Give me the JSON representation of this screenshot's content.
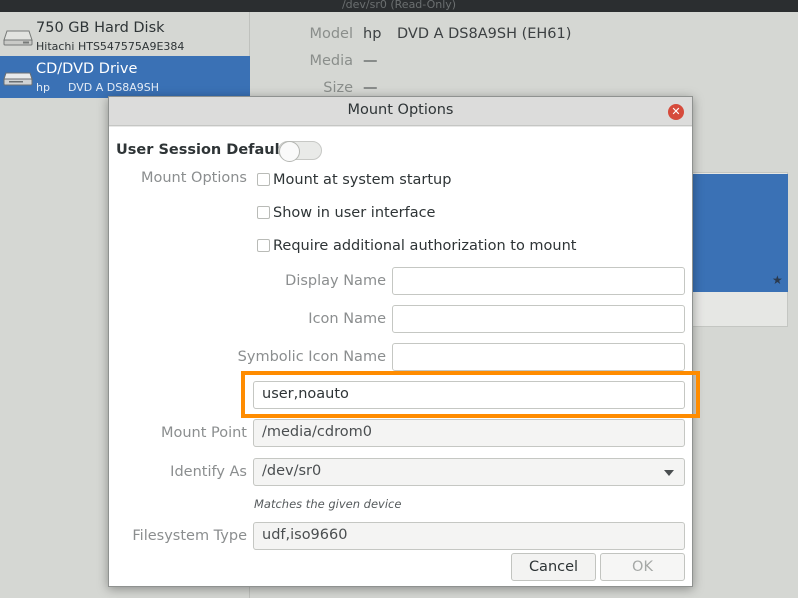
{
  "window": {
    "title": "/dev/sr0 (Read-Only)"
  },
  "sidebar": {
    "items": [
      {
        "name": "750 GB Hard Disk",
        "vendor": "Hitachi HTS547575A9E384",
        "model": "",
        "icon": "harddisk-icon",
        "selected": false
      },
      {
        "name": "CD/DVD Drive",
        "vendor": "hp",
        "model": "DVD A  DS8A9SH",
        "icon": "optical-drive-icon",
        "selected": true
      }
    ]
  },
  "details": {
    "model_label": "Model",
    "model_vendor": "hp",
    "model_value": "DVD A  DS8A9SH (EH61)",
    "media_label": "Media",
    "media_value": "—",
    "size_label": "Size",
    "size_value": "—"
  },
  "dialog": {
    "title": "Mount Options",
    "user_session_defaults_label": "User Session Defaults",
    "user_session_defaults_on": false,
    "mount_options_label": "Mount Options",
    "mount_at_startup_label": "Mount at system startup",
    "show_in_ui_label": "Show in user interface",
    "require_auth_label": "Require additional authorization to mount",
    "display_name_label": "Display Name",
    "display_name_value": "",
    "icon_name_label": "Icon Name",
    "icon_name_value": "",
    "symbolic_icon_name_label": "Symbolic Icon Name",
    "symbolic_icon_name_value": "",
    "options_value": "user,noauto",
    "mount_point_label": "Mount Point",
    "mount_point_value": "/media/cdrom0",
    "identify_as_label": "Identify As",
    "identify_as_value": "/dev/sr0",
    "identify_hint": "Matches the given device",
    "filesystem_type_label": "Filesystem Type",
    "filesystem_type_value": "udf,iso9660",
    "cancel_label": "Cancel",
    "ok_label": "OK"
  },
  "colors": {
    "selection": "#3a71b5",
    "highlight": "#ff8c00",
    "close_button": "#d64b3c"
  }
}
